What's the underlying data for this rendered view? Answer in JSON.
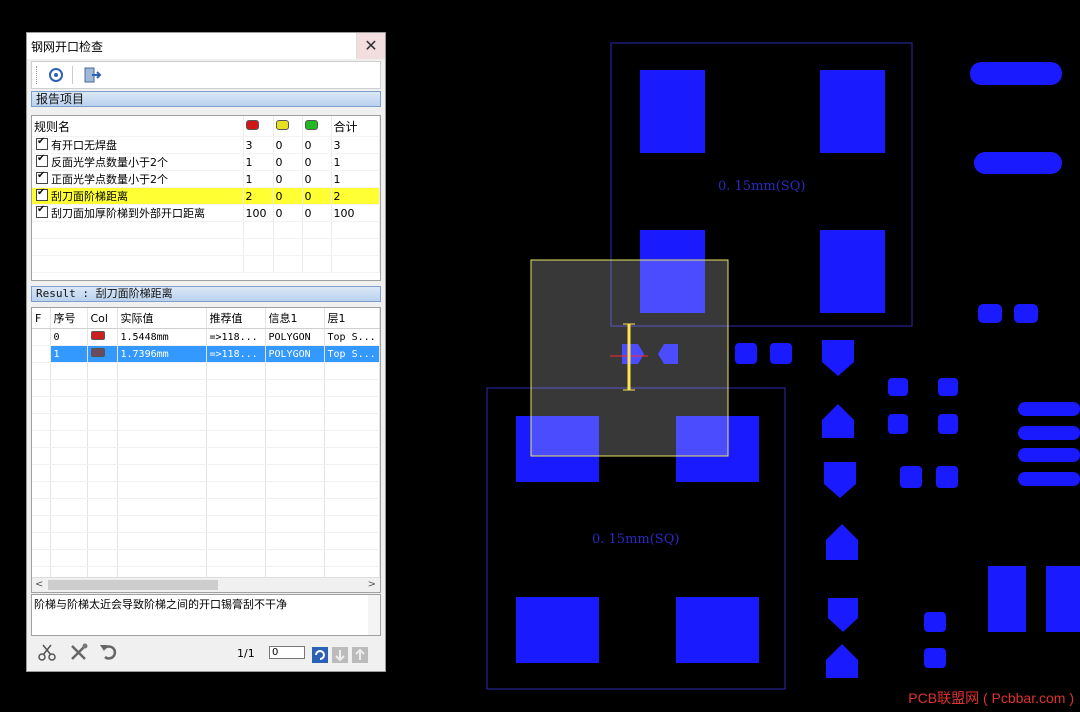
{
  "dialog": {
    "title": "钢网开口检查",
    "close_symbol": "✕",
    "section_report": "报告项目",
    "rules_table": {
      "header": {
        "name": "规则名",
        "total": "合计"
      },
      "legend_colors": [
        "#d01818",
        "#e6e020",
        "#22b822"
      ],
      "rows": [
        {
          "name": "有开口无焊盘",
          "c1": "3",
          "c2": "0",
          "c3": "0",
          "total": "3"
        },
        {
          "name": "反面光学点数量小于2个",
          "c1": "1",
          "c2": "0",
          "c3": "0",
          "total": "1"
        },
        {
          "name": "正面光学点数量小于2个",
          "c1": "1",
          "c2": "0",
          "c3": "0",
          "total": "1"
        },
        {
          "name": "刮刀面阶梯距离",
          "c1": "2",
          "c2": "0",
          "c3": "0",
          "total": "2"
        },
        {
          "name": "刮刀面加厚阶梯到外部开口距离",
          "c1": "100",
          "c2": "0",
          "c3": "0",
          "total": "100"
        }
      ]
    },
    "section_result": "Result : 刮刀面阶梯距离",
    "result_table": {
      "headers": [
        "F",
        "序号",
        "Col",
        "实际值",
        "推荐值",
        "信息1",
        "层1"
      ],
      "rows": [
        {
          "no": "0",
          "color": "#cc1f1f",
          "actual": "1.5448mm",
          "recommended": "=>118...",
          "info1": "POLYGON",
          "layer1": "Top S..."
        },
        {
          "no": "1",
          "color": "#6a4a5c",
          "actual": "1.7396mm",
          "recommended": "=>118...",
          "info1": "POLYGON",
          "layer1": "Top S..."
        }
      ]
    },
    "scroll_left": "<",
    "scroll_right": ">",
    "description": "阶梯与阶梯太近会导致阶梯之间的开口锡膏刮不干净",
    "pager": {
      "label": "1/1",
      "input_value": "0"
    }
  },
  "pcb": {
    "label_top": "0. 15mm(SQ)",
    "label_bottom": "0. 15mm(SQ)",
    "pad_color": "#1a1aff",
    "outline_color": "#2a2ab0"
  },
  "watermark": "PCB联盟网 ( Pcbbar.com )"
}
